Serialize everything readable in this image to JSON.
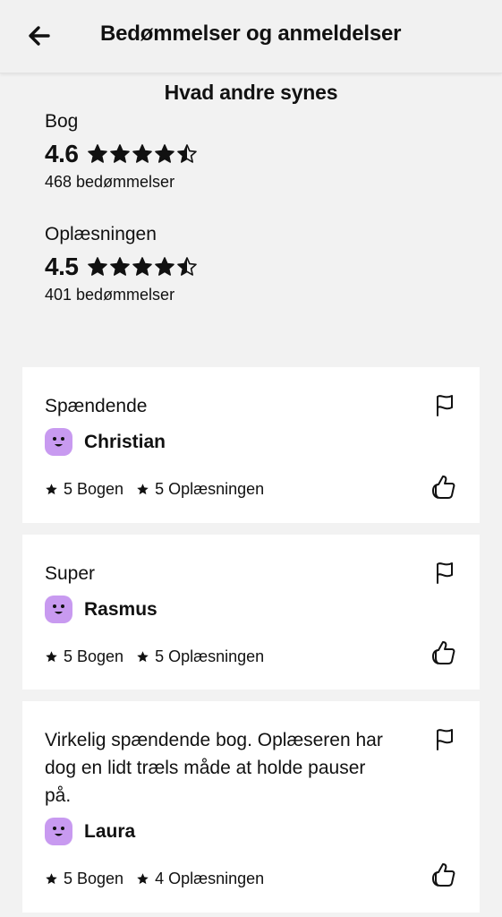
{
  "header": {
    "title": "Bedømmelser og anmeldelser",
    "back_icon": "arrow-left-icon"
  },
  "summary": {
    "title": "Hvad andre synes",
    "book": {
      "label": "Bog",
      "score": "4.6",
      "stars_filled": 4,
      "stars_half": 1,
      "count": "468 bedømmelser"
    },
    "narration": {
      "label": "Oplæsningen",
      "score": "4.5",
      "stars_filled": 4,
      "stars_half": 1,
      "count": "401 bedømmelser"
    }
  },
  "reviews": [
    {
      "text": "Spændende",
      "author": "Christian",
      "book_rating": "5 Bogen",
      "narration_rating": "5 Oplæsningen"
    },
    {
      "text": "Super",
      "author": "Rasmus",
      "book_rating": "5 Bogen",
      "narration_rating": "5 Oplæsningen"
    },
    {
      "text": "Virkelig spændende bog. Oplæseren har dog en lidt træls måde at holde pauser på.",
      "author": "Laura",
      "book_rating": "5 Bogen",
      "narration_rating": "4 Oplæsningen"
    }
  ],
  "colors": {
    "background": "#f2f2f2",
    "card": "#ffffff",
    "avatar": "#c89af0",
    "text": "#111111"
  },
  "icons": {
    "flag": "flag-icon",
    "like": "thumbs-up-icon",
    "star": "star-icon",
    "avatar": "smiley-avatar-icon"
  }
}
